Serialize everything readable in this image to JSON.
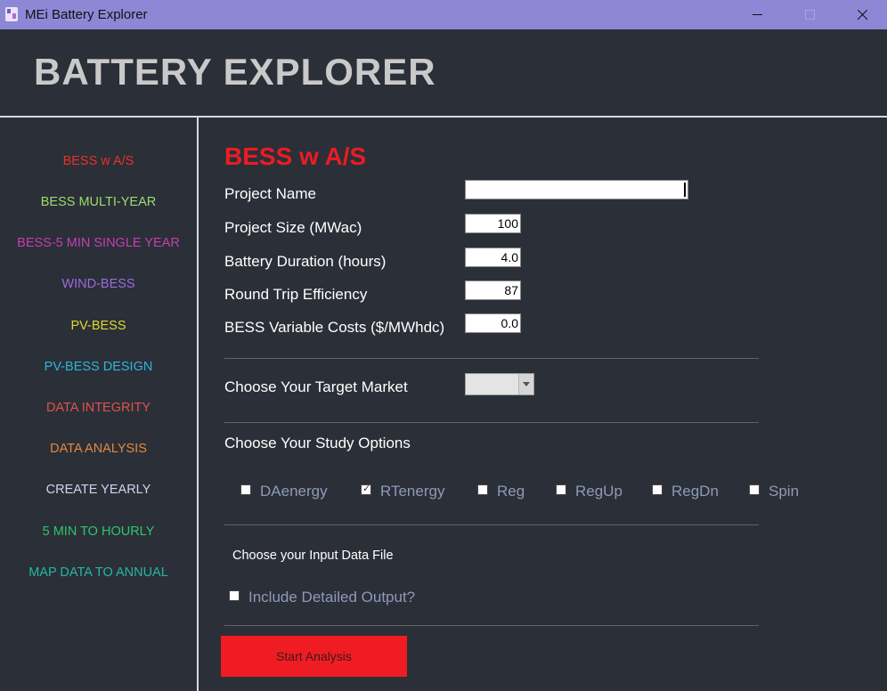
{
  "window": {
    "title": "MEi Battery Explorer"
  },
  "header": {
    "title": "BATTERY EXPLORER"
  },
  "nav": [
    {
      "label": "BESS w A/S",
      "color": "#e8312b"
    },
    {
      "label": "BESS MULTI-YEAR",
      "color": "#9bdc6b"
    },
    {
      "label": "BESS-5 MIN SINGLE YEAR",
      "color": "#c43faf"
    },
    {
      "label": "WIND-BESS",
      "color": "#9c6bdc"
    },
    {
      "label": "PV-BESS",
      "color": "#e1d82d"
    },
    {
      "label": "PV-BESS DESIGN",
      "color": "#2cb6d8"
    },
    {
      "label": "DATA INTEGRITY",
      "color": "#e0524a"
    },
    {
      "label": "DATA ANALYSIS",
      "color": "#e28a3c"
    },
    {
      "label": "CREATE YEARLY",
      "color": "#d2d2f0"
    },
    {
      "label": "5 MIN TO HOURLY",
      "color": "#2cc76b"
    },
    {
      "label": "MAP DATA TO ANNUAL",
      "color": "#24b7a6"
    }
  ],
  "main": {
    "section_title": "BESS w A/S",
    "fields": [
      {
        "label": "Project Name",
        "value": ""
      },
      {
        "label": "Project Size (MWac)",
        "value": "100"
      },
      {
        "label": "Battery Duration (hours)",
        "value": "4.0"
      },
      {
        "label": "Round Trip Efficiency",
        "value": "87"
      },
      {
        "label": "BESS Variable Costs ($/MWhdc)",
        "value": "0.0"
      }
    ],
    "target_market_label": "Choose Your Target Market",
    "target_market_value": "",
    "study_options_label": "Choose Your Study Options",
    "study_options": [
      {
        "label": "DAenergy",
        "checked": false
      },
      {
        "label": "RTenergy",
        "checked": true
      },
      {
        "label": "Reg",
        "checked": false
      },
      {
        "label": "RegUp",
        "checked": false
      },
      {
        "label": "RegDn",
        "checked": false
      },
      {
        "label": "Spin",
        "checked": false
      }
    ],
    "input_file_label": "Choose your Input Data File",
    "detailed_output_label": "Include Detailed Output?",
    "detailed_output_checked": false,
    "start_button": "Start Analysis"
  }
}
